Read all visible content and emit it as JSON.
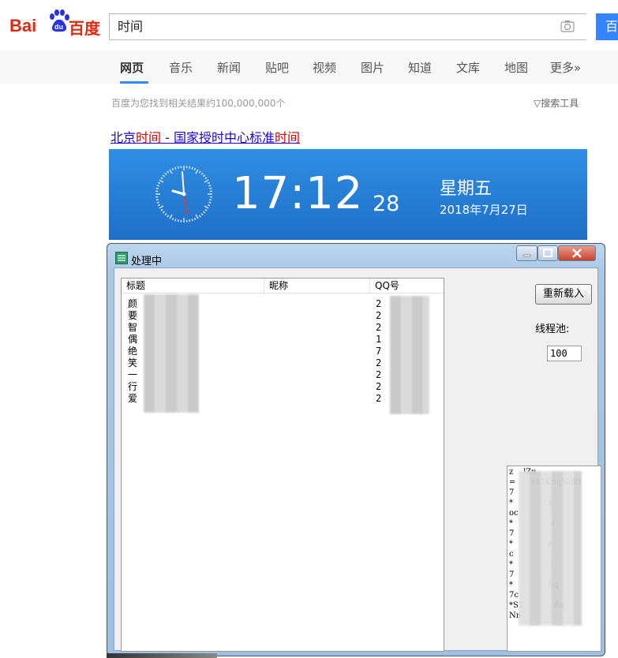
{
  "baidu": {
    "logo_bai": "Bai",
    "logo_du": "百度",
    "search_value": "时间",
    "search_button": "百",
    "nav": [
      {
        "label": "网页",
        "active": true
      },
      {
        "label": "音乐"
      },
      {
        "label": "新闻"
      },
      {
        "label": "贴吧"
      },
      {
        "label": "视频"
      },
      {
        "label": "图片"
      },
      {
        "label": "知道"
      },
      {
        "label": "文库"
      },
      {
        "label": "地图"
      },
      {
        "label": "更多»"
      }
    ],
    "result_count": "百度为您找到相关结果约100,000,000个",
    "search_tools": "搜索工具",
    "result_title_parts": [
      "北京",
      "时间",
      " - 国家授时中心标准",
      "时间"
    ],
    "time_card": {
      "time": "17:12",
      "seconds": "28",
      "weekday": "星期五",
      "date": "2018年7月27日"
    }
  },
  "dialog": {
    "title": "处理中",
    "columns": [
      "标题",
      "昵称",
      "QQ号"
    ],
    "rows": [
      {
        "title": "颜",
        "qq": "2"
      },
      {
        "title": "要",
        "qq": "2"
      },
      {
        "title": "智",
        "qq": "2"
      },
      {
        "title": "偶",
        "qq": "1"
      },
      {
        "title": "绝",
        "qq": "7"
      },
      {
        "title": "笑",
        "qq": "2"
      },
      {
        "title": "一",
        "qq": "2"
      },
      {
        "title": "行",
        "qq": "2"
      },
      {
        "title": "爱",
        "qq": "2"
      }
    ],
    "reload_button": "重新载入",
    "pool_label": "线程池:",
    "pool_value": "100",
    "log_lines": [
      "z    lZn",
      "=      y17KnqNeEi",
      "7",
      "*              z",
      "oc",
      "*               s",
      "7",
      "*              z",
      "c",
      "*               l",
      "7",
      "*              Sq",
      "7c",
      "*S1            Eq",
      "Nn"
    ]
  }
}
